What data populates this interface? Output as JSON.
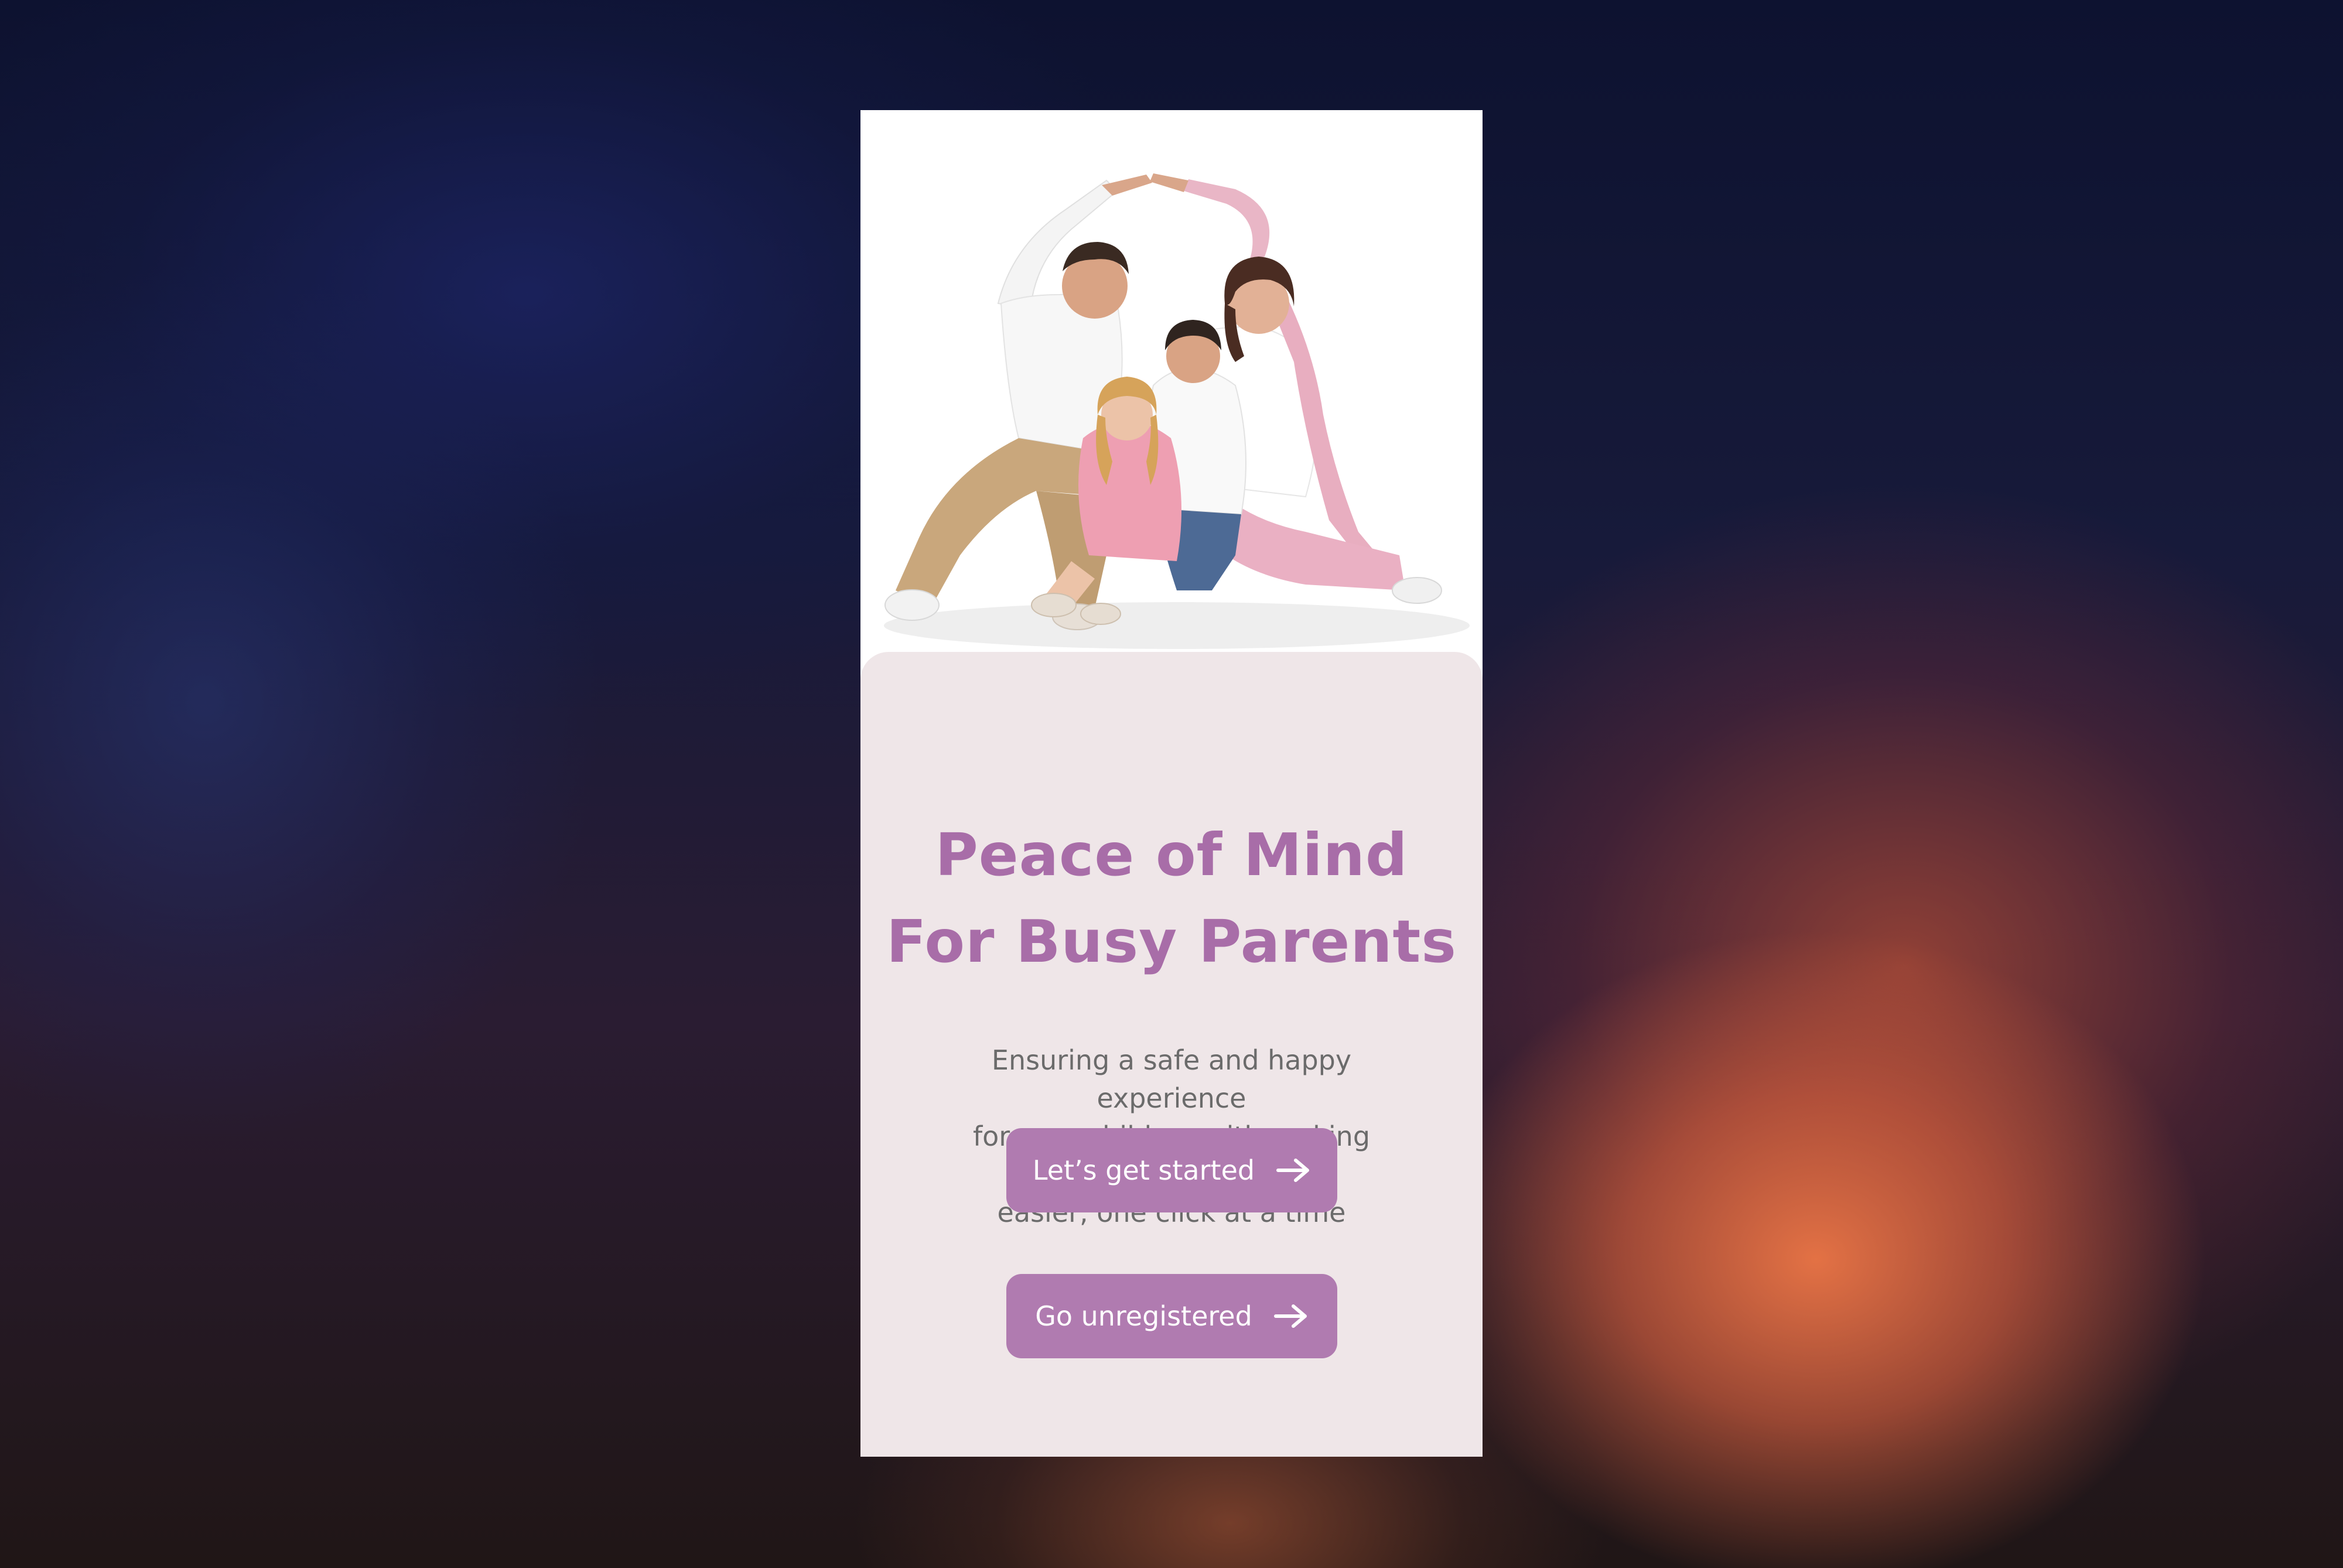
{
  "app": {
    "accent_color": "#a86da8",
    "button_color": "#b07bb0",
    "card_background": "#efe6e8"
  },
  "hero": {
    "image": "family-photo",
    "description_icon": "family-house-hands-image"
  },
  "headline": {
    "line1": "Peace of Mind",
    "line2": "For Busy Parents"
  },
  "subtitle": {
    "line1": "Ensuring a safe and happy experience",
    "line2": "for your children with making parenthood",
    "line3": "easier, one click at a time"
  },
  "buttons": {
    "start_label": "Let’s get started",
    "start_icon": "arrow-right-icon",
    "unregistered_label": "Go unregistered",
    "unregistered_icon": "arrow-right-icon"
  }
}
